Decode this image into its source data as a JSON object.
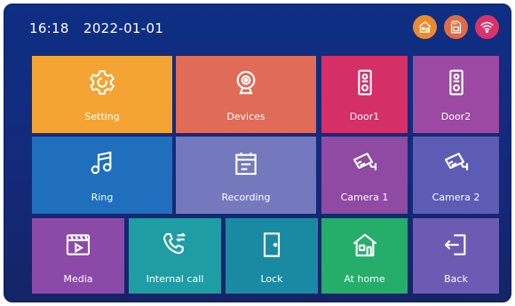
{
  "status_bar": {
    "time": "16:18",
    "date": "2022-01-01",
    "icons": [
      {
        "name": "home-mode-icon",
        "color": "#ef8a2b"
      },
      {
        "name": "sd-card-icon",
        "color": "#e06b44"
      },
      {
        "name": "wifi-icon",
        "color": "#d9326b"
      }
    ]
  },
  "tiles": [
    {
      "label": "Setting",
      "icon": "gear-icon",
      "color": "#f4a433"
    },
    {
      "label": "Devices",
      "icon": "webcam-icon",
      "color": "#e06b56"
    },
    {
      "label": "Door1",
      "icon": "door-station-icon",
      "color": "#d42f66"
    },
    {
      "label": "Door2",
      "icon": "door-station-icon",
      "color": "#9b49a3"
    },
    {
      "label": "Ring",
      "icon": "music-note-icon",
      "color": "#1f6fbd"
    },
    {
      "label": "Recording",
      "icon": "calendar-icon",
      "color": "#7479bd"
    },
    {
      "label": "Camera 1",
      "icon": "cctv-camera-icon",
      "color": "#8f4aa3"
    },
    {
      "label": "Camera 2",
      "icon": "cctv-camera-icon",
      "color": "#5d5cb4"
    },
    {
      "label": "Media",
      "icon": "video-file-icon",
      "color": "#8c4aa8"
    },
    {
      "label": "Internal call",
      "icon": "phone-transfer-icon",
      "color": "#1f9da4"
    },
    {
      "label": "Lock",
      "icon": "door-icon",
      "color": "#1a8aa3"
    },
    {
      "label": "At home",
      "icon": "house-icon",
      "color": "#25ad6a"
    },
    {
      "label": "Back",
      "icon": "exit-icon",
      "color": "#6c5bb3"
    }
  ]
}
